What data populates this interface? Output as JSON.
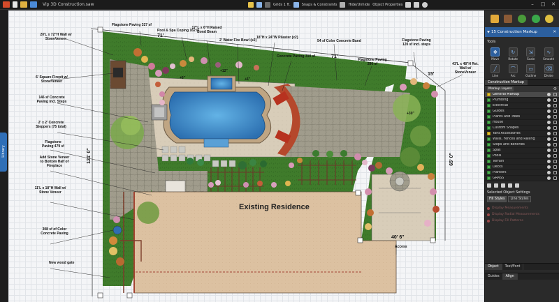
{
  "titlebar": {
    "title": "Vip 3D Construction.saw",
    "tools": [
      "Grids 1 ft.",
      "Snaps & Constraints",
      "Hide/Unhide",
      "Object Properties"
    ]
  },
  "library_tab": "Library",
  "canvas": {
    "existing_residence": "Existing Residence",
    "labels": [
      "Flagstone Paving 327 sf",
      "Pool & Spa Coping 162 lf",
      "17\"L x 6\"H Raised Bond Beam",
      "2' Water Fire Bowl (x2)",
      "18\"H x 24\"W Pilaster (x2)",
      "54 sf Color Concrete Band",
      "Concrete Paving 319 sf",
      "Flagstone Paving 290 sf",
      "Flagstone Paving 120 sf incl. steps",
      "20'L x 72\"H Wall w/ StoneVeneer",
      "43'L x 48\"H Ret. Wall w/ StoneVeneer",
      "6' Square Firepit w/ StoneVeneer",
      "146 sf Concrete Paving incl. Steps",
      "2' x 2' Concrete Steppers (75 total)",
      "Flagstone Paving 479 sf",
      "Add Stone Veneer to Bottom Half of Fireplace",
      "11'L x 18\"H Wall w/ Stone Veneer",
      "308 sf of Color Concrete Paving",
      "New wood gate",
      "Access"
    ],
    "dimensions": [
      "71'",
      "71'",
      "15'",
      "65' 0\"",
      "121' 0\"",
      "40' 6\"",
      "+6\"",
      "+12\"",
      "+6\"",
      "+30\""
    ]
  },
  "panel": {
    "header": "15 Construction Markup",
    "tools_label": "Tools",
    "tools": [
      "Move",
      "Rotate",
      "Scale",
      "Smooth",
      "Line",
      "Arc",
      "Outline",
      "Divide"
    ],
    "tab_construction": "Construction Markup",
    "markup_layers_label": "Markup Layers",
    "layers": [
      "General Markup",
      "Plumbing",
      "Electrical",
      "Guides",
      "Plants and Trees",
      "House",
      "Custom Shapes",
      "Yard Accessories",
      "Walls, Fences and Railing",
      "Steps and Benches",
      "Spas",
      "Pools",
      "Terrain",
      "Decks",
      "Planters",
      "GRASS"
    ],
    "selected_object_settings": "Selected Object Settings",
    "style_tabs": [
      "Fill Styles",
      "Line Styles"
    ],
    "options": [
      "Display Measurements",
      "Display Radial Measurements",
      "Display Fill Patterns"
    ],
    "bottom_tabs_1": [
      "Object",
      "Text/Font"
    ],
    "bottom_tabs_2": [
      "Guides",
      "Align"
    ]
  },
  "colors": {
    "grass": "#3f7a2a",
    "paving": "#d7ccb7",
    "flagstone": "#9a9686",
    "residence": "#dcc0a0",
    "pool_water": "#3e88c8",
    "brick": "#8a3b2d",
    "panel_accent": "#2c5f9e"
  }
}
